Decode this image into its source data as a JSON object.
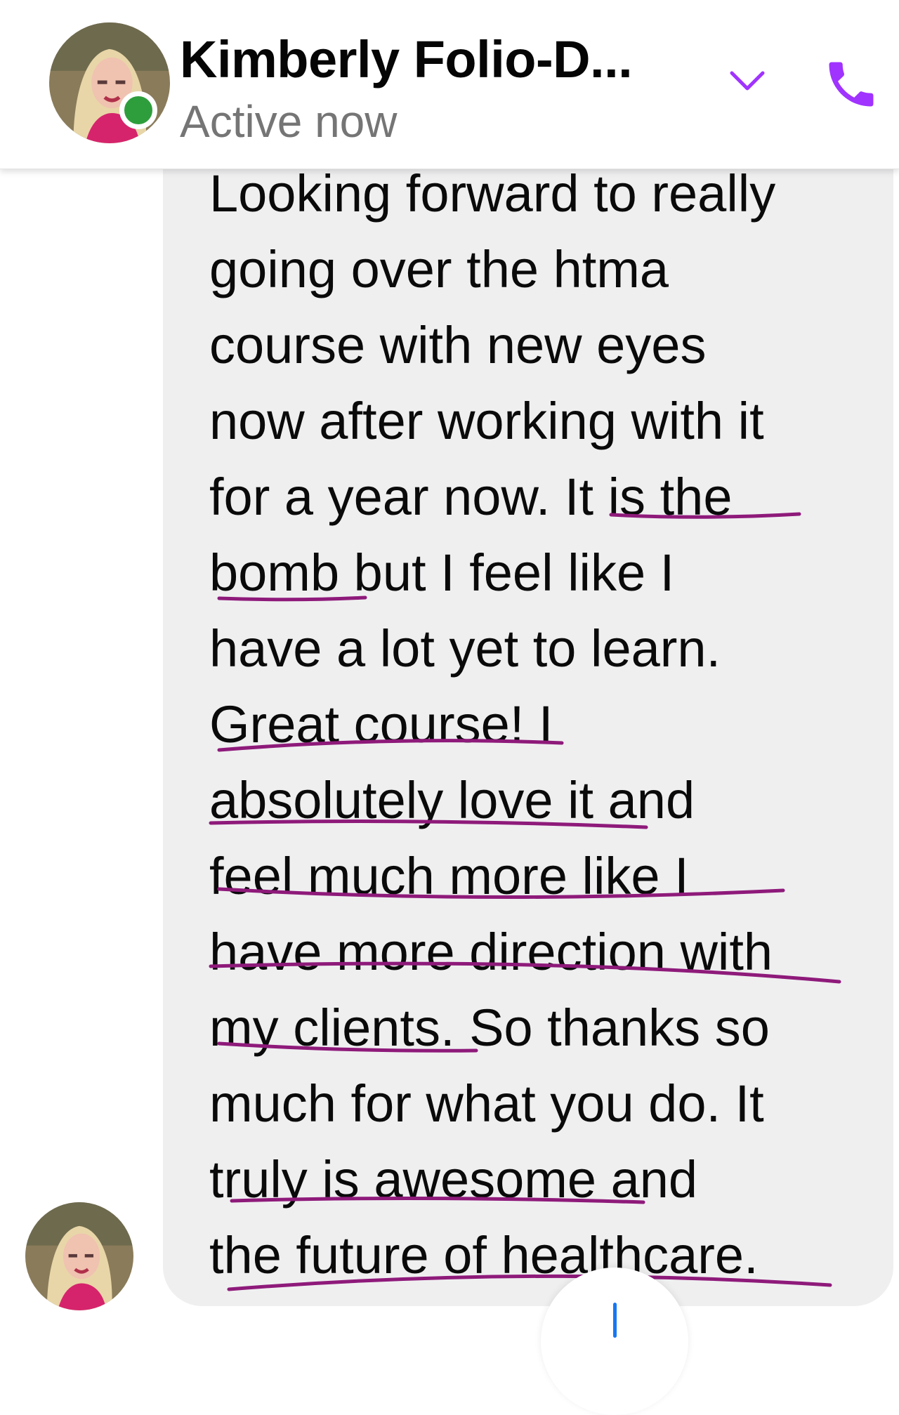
{
  "header": {
    "contact_name": "Kimberly Folio-D...",
    "status": "Active now",
    "expand_icon": "chevron-down-icon",
    "call_icon": "phone-icon",
    "accent_color": "#a033ff"
  },
  "message": {
    "lines": [
      "Looking forward to really",
      "going over the htma",
      "course with new eyes",
      "now after working with it",
      "for a year now. It is the",
      "bomb but I feel like I",
      "have a lot yet to learn.",
      "Great course! I",
      "absolutely love it and",
      "feel much more like I",
      "have more direction with",
      "my clients. So thanks so",
      "much for what you do. It",
      "truly is awesome and",
      "the future of healthcare."
    ],
    "bubble_color": "#efeff0",
    "underline_color": "#8e1a7a"
  },
  "scroll_button": {
    "icon": "arrow-down-icon"
  }
}
